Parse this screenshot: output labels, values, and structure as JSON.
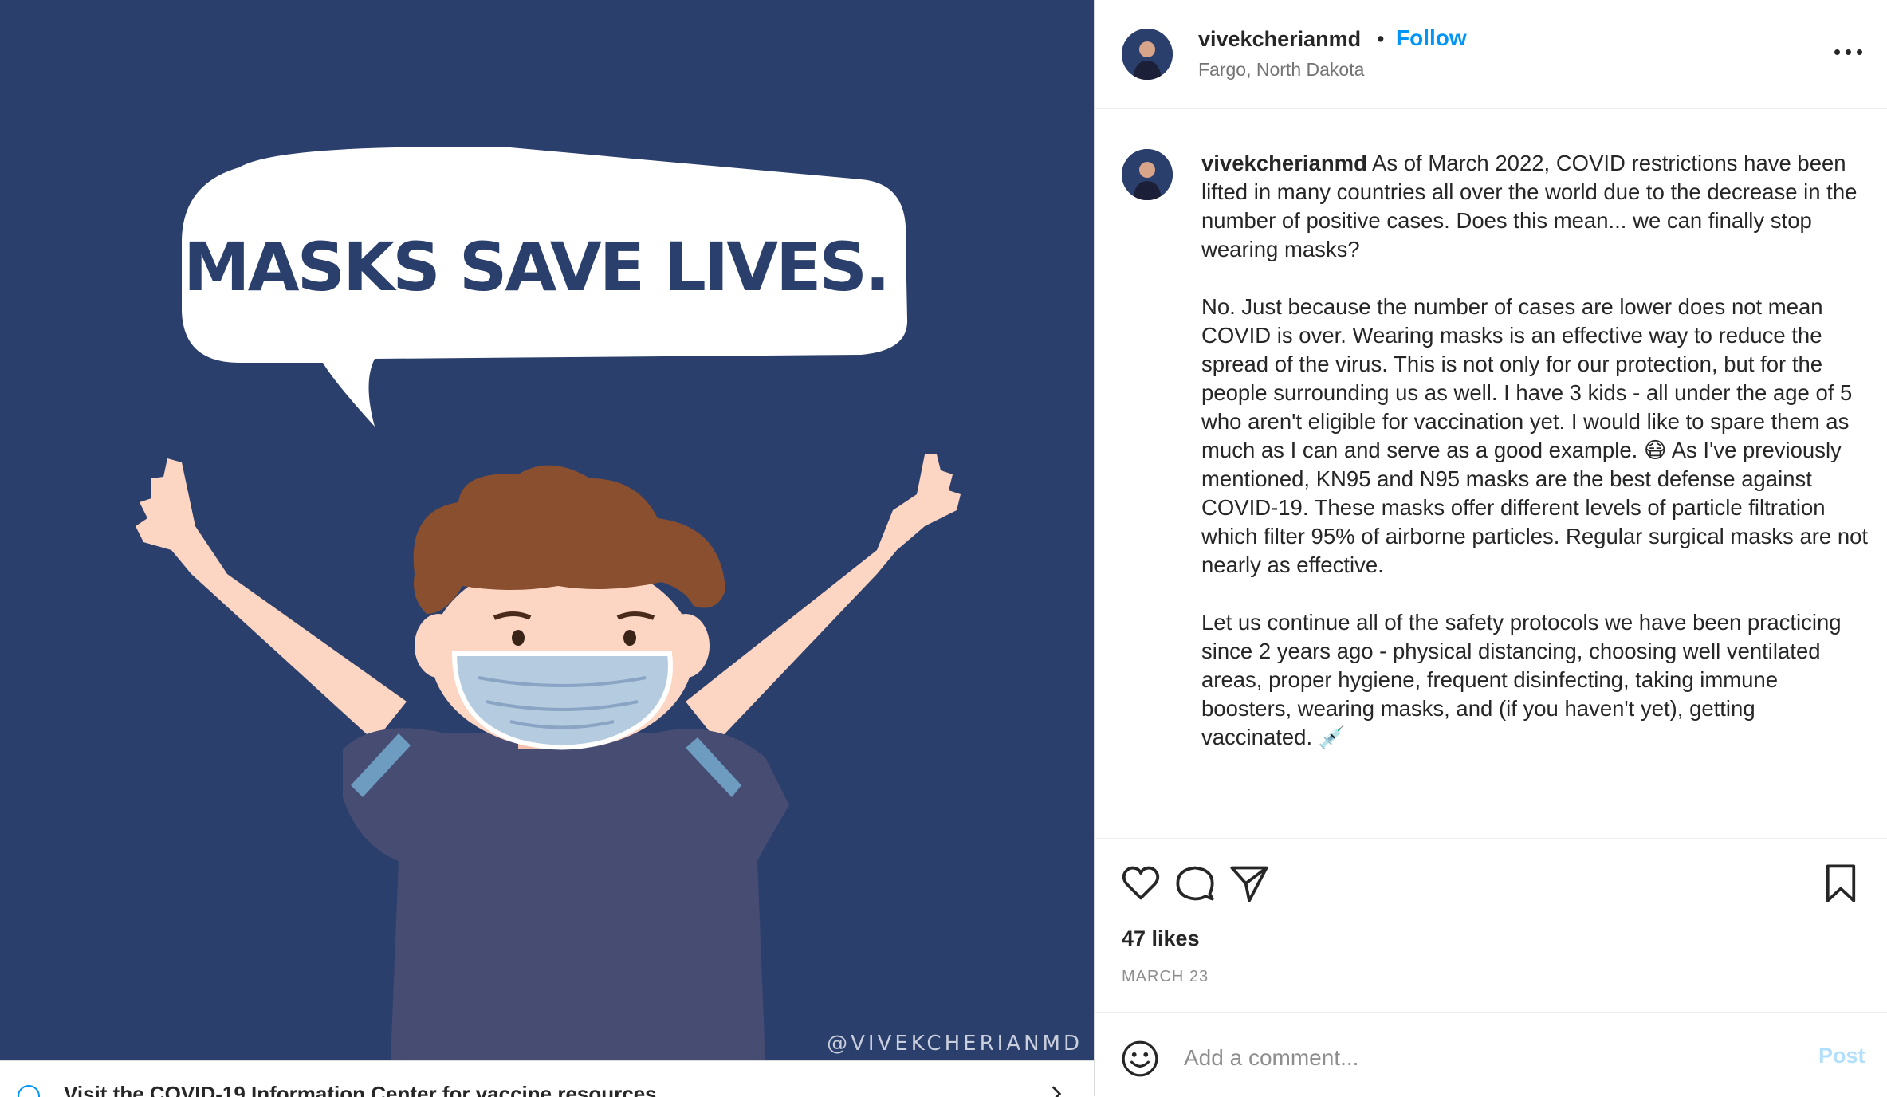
{
  "colors": {
    "image_background": "#2b3f6c",
    "accent_blue": "#0095f6",
    "post_disabled": "#b2dffc",
    "muted_text": "#8e8e8e"
  },
  "media": {
    "headline": "MASKS SAVE LIVES.",
    "watermark": "@VIVEKCHERIANMD",
    "info_bar_text": "Visit the COVID-19 Information Center for vaccine resources",
    "info_icon": "info-icon",
    "chevron_icon": "chevron-right-icon"
  },
  "header": {
    "username": "vivekcherianmd",
    "separator": "•",
    "follow_label": "Follow",
    "location": "Fargo, North Dakota",
    "more_icon": "more-options-icon"
  },
  "caption": {
    "username": "vivekcherianmd",
    "paragraph1": "As of March 2022, COVID restrictions have been lifted in many countries all over the world due to the decrease in the number of positive cases. Does this mean... we can finally stop wearing masks?",
    "paragraph2": "No. Just because the number of cases are lower does not mean COVID is over. Wearing masks is an effective way to reduce the spread of the virus. This is not only for our protection, but for the people surrounding us as well. I have 3 kids - all under the age of 5 who aren't eligible for vaccination yet. I would like to spare them as much as I can and serve as a good example. 😷 As I've previously mentioned, KN95 and N95 masks are the best defense against COVID-19. These masks offer different levels of particle filtration which filter 95% of airborne particles. Regular surgical masks are not nearly as effective.",
    "paragraph3": "Let us continue all of the safety protocols we have been practicing since 2 years ago - physical distancing, choosing well ventilated areas, proper hygiene, frequent disinfecting, taking immune boosters, wearing masks, and (if you haven't yet), getting vaccinated. 💉"
  },
  "actions": {
    "icons": [
      "heart-icon",
      "comment-icon",
      "share-icon",
      "bookmark-icon"
    ],
    "likes": "47 likes",
    "date": "MARCH 23"
  },
  "comment": {
    "placeholder": "Add a comment...",
    "post_label": "Post",
    "emoji_icon": "emoji-icon"
  }
}
